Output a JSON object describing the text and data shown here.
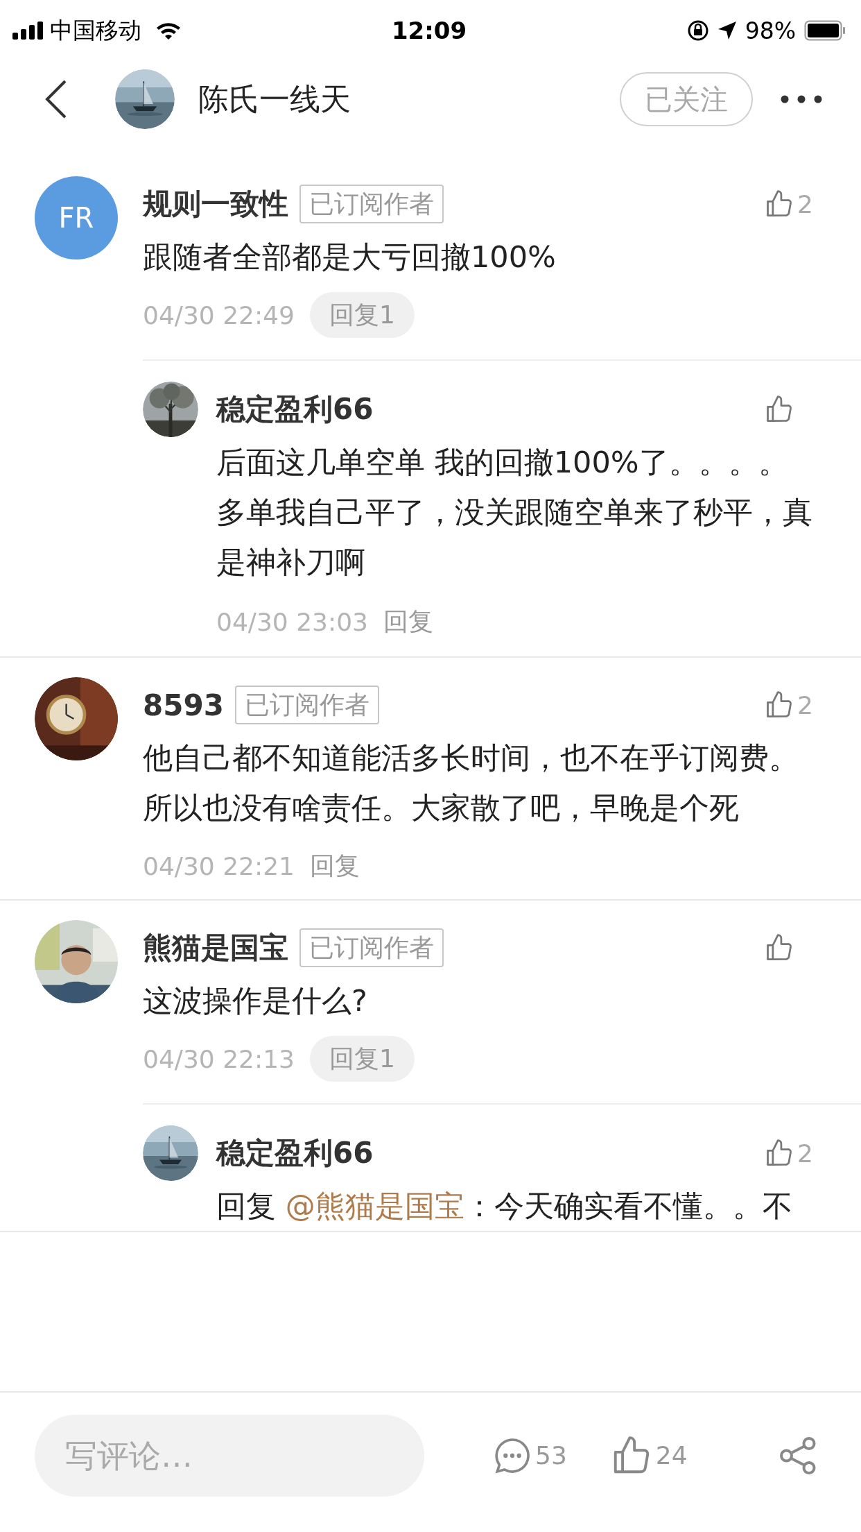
{
  "status_bar": {
    "carrier": "中国移动",
    "time": "12:09",
    "battery": "98%"
  },
  "header": {
    "author": "陈氏一线天",
    "follow_button": "已关注"
  },
  "comments": [
    {
      "avatar": {
        "kind": "initials",
        "text": "FR"
      },
      "name": "规则一致性",
      "tag": "已订阅作者",
      "likes": "2",
      "text": "跟随者全部都是大亏回撤100%",
      "time": "04/30 22:49",
      "reply": {
        "kind": "pill",
        "label": "回复1"
      },
      "replies": [
        {
          "name": "稳定盈利66",
          "text": "后面这几单空单 我的回撤100%了。。。。多单我自己平了，没关跟随空单来了秒平，真是神补刀啊",
          "time": "04/30 23:03",
          "reply": {
            "kind": "plain",
            "label": "回复"
          }
        }
      ]
    },
    {
      "name": "8593",
      "tag": "已订阅作者",
      "likes": "2",
      "text": "他自己都不知道能活多长时间，也不在乎订阅费。所以也没有啥责任。大家散了吧，早晚是个死",
      "time": "04/30 22:21",
      "reply": {
        "kind": "plain",
        "label": "回复"
      }
    },
    {
      "name": "熊猫是国宝",
      "tag": "已订阅作者",
      "text": "这波操作是什么?",
      "time": "04/30 22:13",
      "reply": {
        "kind": "pill",
        "label": "回复1"
      },
      "replies": [
        {
          "name": "稳定盈利66",
          "likes": "2",
          "prefix": "回复 ",
          "mention": "@熊猫是国宝",
          "text": "：今天确实看不懂。。不"
        }
      ]
    }
  ],
  "bottom_bar": {
    "placeholder": "写评论…",
    "comment_count": "53",
    "like_count": "24"
  }
}
